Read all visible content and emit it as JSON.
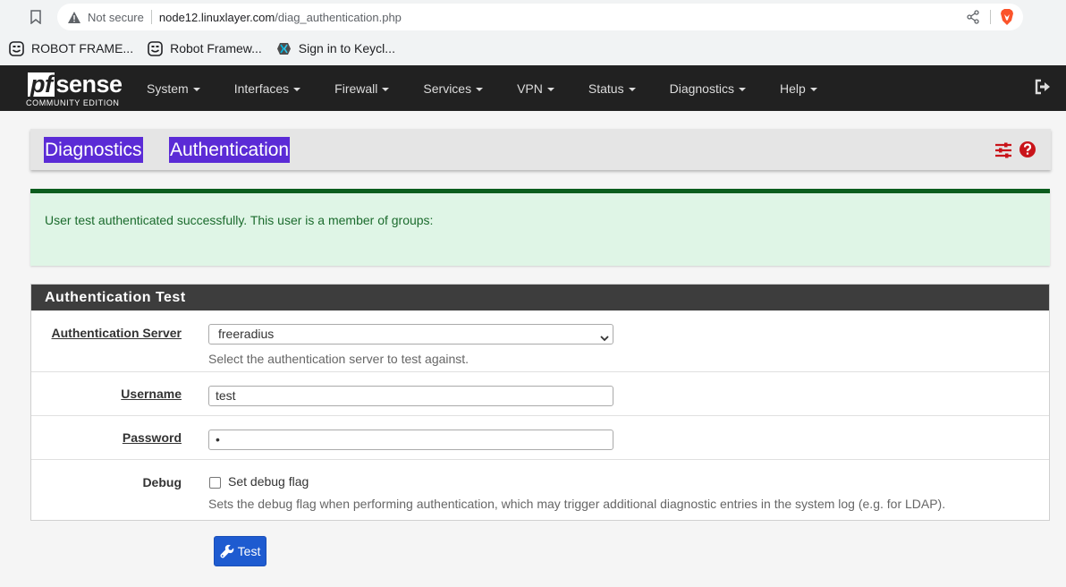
{
  "browser": {
    "security_label": "Not secure",
    "url_host": "node12.linuxlayer.com",
    "url_path": "/diag_authentication.php",
    "bookmarks": [
      {
        "label": "ROBOT FRAME...",
        "icon": "robot-icon"
      },
      {
        "label": "Robot Framew...",
        "icon": "robot-icon"
      },
      {
        "label": "Sign in to Keycl...",
        "icon": "keycloak-icon"
      }
    ]
  },
  "navbar": {
    "logo_pf": "pf",
    "logo_sense": "sense",
    "logo_sub": "COMMUNITY EDITION",
    "menu": [
      "System",
      "Interfaces",
      "Firewall",
      "Services",
      "VPN",
      "Status",
      "Diagnostics",
      "Help"
    ]
  },
  "breadcrumb": {
    "section": "Diagnostics",
    "separator": "/",
    "page": "Authentication"
  },
  "alert": {
    "message": "User test authenticated successfully. This user is a member of groups:"
  },
  "panel": {
    "title": "Authentication Test",
    "auth_server": {
      "label": "Authentication Server",
      "value": "freeradius",
      "help": "Select the authentication server to test against."
    },
    "username": {
      "label": "Username",
      "value": "test"
    },
    "password": {
      "label": "Password",
      "value": "•"
    },
    "debug": {
      "label": "Debug",
      "checkbox_label": "Set debug flag",
      "checked": false,
      "help": "Sets the debug flag when performing authentication, which may trigger additional diagnostic entries in the system log (e.g. for LDAP)."
    }
  },
  "actions": {
    "test_label": "Test"
  },
  "colors": {
    "navbar_bg": "#212121",
    "highlight": "#5b2bd6",
    "alert_bg": "#dff5e6",
    "alert_border": "#0b5d1e",
    "button": "#1e5bd0",
    "help_red": "#c9141a"
  }
}
